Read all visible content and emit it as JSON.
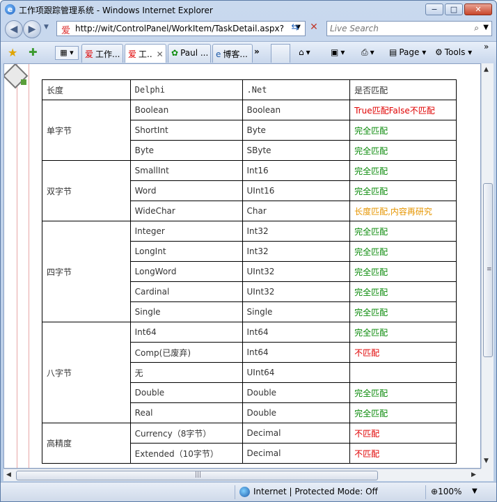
{
  "window": {
    "title": "工作项跟踪管理系统 - Windows Internet Explorer",
    "minimize": "−",
    "maximize": "□",
    "close": "✕"
  },
  "address": {
    "url": "http://wit/ControlPanel/WorkItem/TaskDetail.aspx?Ta",
    "search_placeholder": "Live Search"
  },
  "tabs": [
    {
      "label": "工作..."
    },
    {
      "label": "工.."
    },
    {
      "label": "Paul ..."
    },
    {
      "label": "博客..."
    }
  ],
  "tab_more": "»",
  "commands": {
    "page": "Page",
    "tools": "Tools",
    "overflow": "»"
  },
  "table": {
    "header": [
      "长度",
      "Delphi",
      ".Net",
      "是否匹配"
    ],
    "groups": [
      {
        "name": "单字节",
        "rows": [
          {
            "delphi": "Boolean",
            "net": "Boolean",
            "match": "True匹配False不匹配",
            "status": "red"
          },
          {
            "delphi": "ShortInt",
            "net": "Byte",
            "match": "完全匹配",
            "status": "green"
          },
          {
            "delphi": "Byte",
            "net": "SByte",
            "match": "完全匹配",
            "status": "green"
          }
        ]
      },
      {
        "name": "双字节",
        "rows": [
          {
            "delphi": "SmallInt",
            "net": "Int16",
            "match": "完全匹配",
            "status": "green"
          },
          {
            "delphi": "Word",
            "net": "UInt16",
            "match": "完全匹配",
            "status": "green"
          },
          {
            "delphi": "WideChar",
            "net": "Char",
            "match": "长度匹配,内容再研究",
            "status": "orange"
          }
        ]
      },
      {
        "name": "四字节",
        "rows": [
          {
            "delphi": "Integer",
            "net": "Int32",
            "match": "完全匹配",
            "status": "green"
          },
          {
            "delphi": "LongInt",
            "net": "Int32",
            "match": "完全匹配",
            "status": "green"
          },
          {
            "delphi": "LongWord",
            "net": "UInt32",
            "match": "完全匹配",
            "status": "green"
          },
          {
            "delphi": "Cardinal",
            "net": "UInt32",
            "match": "完全匹配",
            "status": "green"
          },
          {
            "delphi": "Single",
            "net": "Single",
            "match": "完全匹配",
            "status": "green"
          }
        ]
      },
      {
        "name": "八字节",
        "rows": [
          {
            "delphi": "Int64",
            "net": "Int64",
            "match": "完全匹配",
            "status": "green"
          },
          {
            "delphi": "Comp(已废弃)",
            "net": "Int64",
            "match": "不匹配",
            "status": "red"
          },
          {
            "delphi": "无",
            "net": "UInt64",
            "match": "",
            "status": "none"
          },
          {
            "delphi": "Double",
            "net": "Double",
            "match": "完全匹配",
            "status": "green"
          },
          {
            "delphi": "Real",
            "net": "Double",
            "match": "完全匹配",
            "status": "green"
          }
        ]
      },
      {
        "name": "高精度",
        "rows": [
          {
            "delphi": "Currency（8字节）",
            "net": "Decimal",
            "match": "不匹配",
            "status": "red"
          },
          {
            "delphi": "Extended（10字节）",
            "net": "Decimal",
            "match": "不匹配",
            "status": "red"
          }
        ]
      }
    ]
  },
  "statusbar": {
    "zone": "Internet | Protected Mode: Off",
    "zoom": "100%"
  },
  "colors": {
    "red": "#e00000",
    "green": "#0a8a0a",
    "orange": "#e69500"
  }
}
